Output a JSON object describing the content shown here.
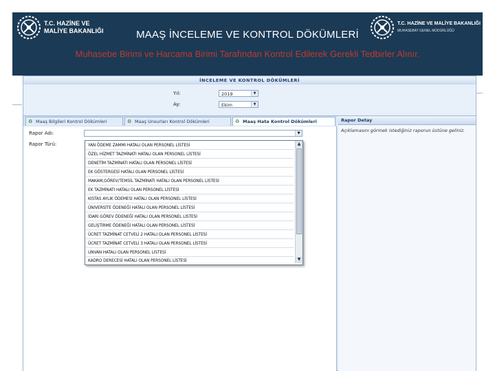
{
  "slide": {
    "title": "MAAŞ İNCELEME VE KONTROL DÖKÜMLERİ",
    "subtitle": "Muhasebe Birimi ve Harcama Birimi Tarafından Kontrol Edilerek Gerekli Tedbirler Alınır."
  },
  "logo_left": {
    "line1": "T.C. HAZİNE VE",
    "line2": "MALİYE BAKANLIĞI"
  },
  "logo_right": {
    "line1": "T.C. HAZİNE VE MALİYE BAKANLIĞI",
    "line2": "MUHASEBAT GENEL MÜDÜRLÜĞÜ"
  },
  "app": {
    "panel_title": "İNCELEME VE KONTROL DÖKÜMLERİ",
    "yil_label": "Yıl:",
    "yil_value": "2019",
    "ay_label": "Ay:",
    "ay_value": "Ekim",
    "tabs": [
      {
        "label": "Maaş Bilgileri Kontrol Dökümleri"
      },
      {
        "label": "Maaş Unsurları Kontrol Dökümleri"
      },
      {
        "label": "Maaş Hata Kontrol Dökümleri"
      }
    ],
    "rapor_adi_label": "Rapor Adı:",
    "rapor_turu_label": "Rapor Türü:",
    "right_panel_title": "Rapor Detay",
    "right_panel_desc": "Açıklamasını görmek istediğiniz raporun üstüne geliniz.",
    "dropdown_items": [
      "YAN ÖDEME ZAMMI HATALI OLAN PERSONEL LİSTESİ",
      "ÖZEL HİZMET TAZMİNATI HATALI OLAN PERSONEL LİSTESİ",
      "DENETİM TAZMİNATI HATALI OLAN PERSONEL LİSTESİ",
      "EK GÖSTERGESİ HATALI OLAN PERSONEL LİSTESİ",
      "MAKAM,GÖREV/TEMSİL TAZMİNATI HATALI OLAN PERSONEL LİSTESİ",
      "EK TAZMİNATI HATALI OLAN PERSONEL LİSTESİ",
      "KISTAS AYLIK ÖDEMESİ HATALI OLAN PERSONEL LİSTESİ",
      "ÜNİVERSİTE ÖDENEĞİ HATALI OLAN PERSONEL LİSTESİ",
      "İDARİ GÖREV ÖDENEĞİ HATALI OLAN PERSONEL LİSTESİ",
      "GELİŞTİRME ÖDENEĞİ HATALI OLAN PERSONEL LİSTESİ",
      "ÜCRET TAZMİNAT CETVELİ 2 HATALI OLAN PERSONEL LİSTESİ",
      "ÜCRET TAZMİNAT CETVELİ 3 HATALI OLAN PERSONEL LİSTESİ",
      "UNVAN HATALI OLAN PERSONEL LİSTESİ",
      "KADRO DERECESİ HATALI OLAN PERSONEL LİSTESİ"
    ]
  },
  "colors": {
    "header_bg": "#1b3a55",
    "subtitle": "#c0392b",
    "panel_bg": "#dce9f7"
  }
}
